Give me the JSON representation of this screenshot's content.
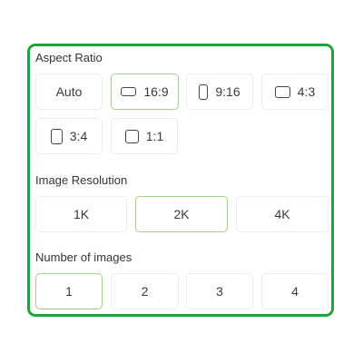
{
  "colors": {
    "panel_border": "#22a33a",
    "selected_border": "#9fd38b",
    "option_border": "#ededed"
  },
  "aspect_ratio": {
    "title": "Aspect Ratio",
    "options": [
      {
        "label": "Auto",
        "icon": "",
        "selected": false
      },
      {
        "label": "16:9",
        "icon": "landscape-rect-icon",
        "selected": true
      },
      {
        "label": "9:16",
        "icon": "portrait-rect-icon",
        "selected": false
      },
      {
        "label": "4:3",
        "icon": "landscape-rect-icon",
        "selected": false
      },
      {
        "label": "3:4",
        "icon": "portrait-rect-icon",
        "selected": false
      },
      {
        "label": "1:1",
        "icon": "square-icon",
        "selected": false
      }
    ]
  },
  "image_resolution": {
    "title": "Image Resolution",
    "options": [
      {
        "label": "1K",
        "selected": false
      },
      {
        "label": "2K",
        "selected": true
      },
      {
        "label": "4K",
        "selected": false
      }
    ]
  },
  "number_of_images": {
    "title": "Number of images",
    "options": [
      {
        "label": "1",
        "selected": true
      },
      {
        "label": "2",
        "selected": false
      },
      {
        "label": "3",
        "selected": false
      },
      {
        "label": "4",
        "selected": false
      }
    ]
  }
}
